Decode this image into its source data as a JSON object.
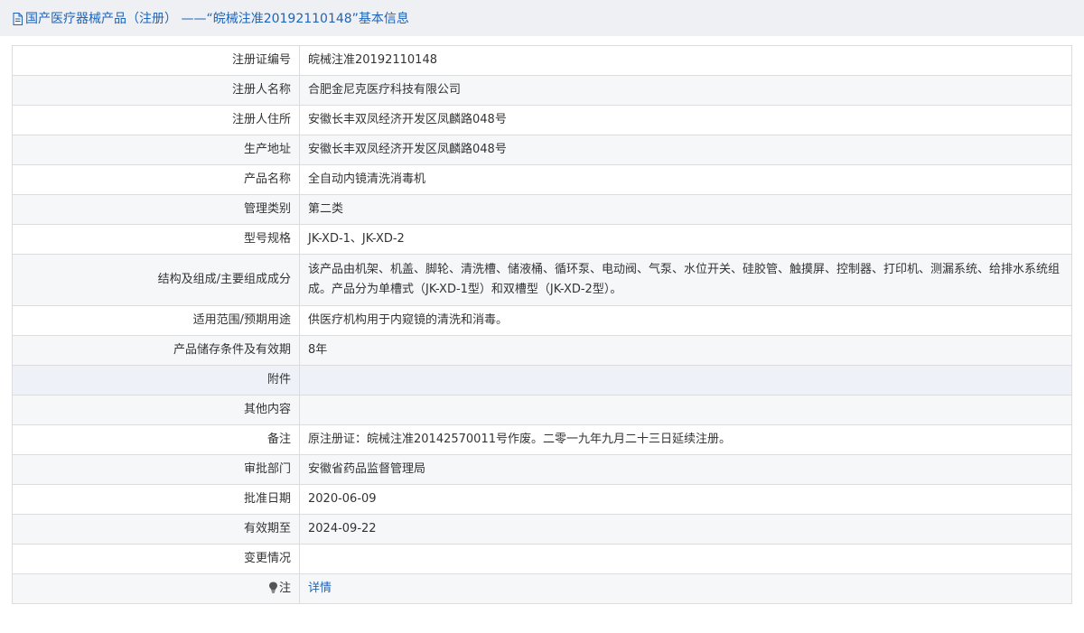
{
  "header": {
    "title": "国产医疗器械产品（注册） ——“皖械注准20192110148”基本信息"
  },
  "rows": [
    {
      "label": "注册证编号",
      "value": "皖械注准20192110148"
    },
    {
      "label": "注册人名称",
      "value": "合肥金尼克医疗科技有限公司"
    },
    {
      "label": "注册人住所",
      "value": "安徽长丰双凤经济开发区凤麟路048号"
    },
    {
      "label": "生产地址",
      "value": "安徽长丰双凤经济开发区凤麟路048号"
    },
    {
      "label": "产品名称",
      "value": "全自动内镜清洗消毒机"
    },
    {
      "label": "管理类别",
      "value": "第二类"
    },
    {
      "label": "型号规格",
      "value": "JK-XD-1、JK-XD-2"
    },
    {
      "label": "结构及组成/主要组成成分",
      "value": "该产品由机架、机盖、脚轮、清洗槽、储液桶、循环泵、电动阀、气泵、水位开关、硅胶管、触摸屏、控制器、打印机、测漏系统、给排水系统组成。产品分为单槽式（JK-XD-1型）和双槽型（JK-XD-2型）。"
    },
    {
      "label": "适用范围/预期用途",
      "value": "供医疗机构用于内窥镜的清洗和消毒。"
    },
    {
      "label": "产品储存条件及有效期",
      "value": "8年"
    },
    {
      "label": "附件",
      "value": ""
    },
    {
      "label": "其他内容",
      "value": ""
    },
    {
      "label": "备注",
      "value": "原注册证：皖械注准20142570011号作废。二零一九年九月二十三日延续注册。"
    },
    {
      "label": "审批部门",
      "value": "安徽省药品监督管理局"
    },
    {
      "label": "批准日期",
      "value": "2020-06-09"
    },
    {
      "label": "有效期至",
      "value": "2024-09-22"
    },
    {
      "label": "变更情况",
      "value": ""
    }
  ],
  "note": {
    "label": "注",
    "link_text": "详情",
    "icon": "lightbulb-icon"
  },
  "colors": {
    "link": "#1f64b8",
    "header_bg": "#eef0f3",
    "border": "#dcdcdc"
  }
}
